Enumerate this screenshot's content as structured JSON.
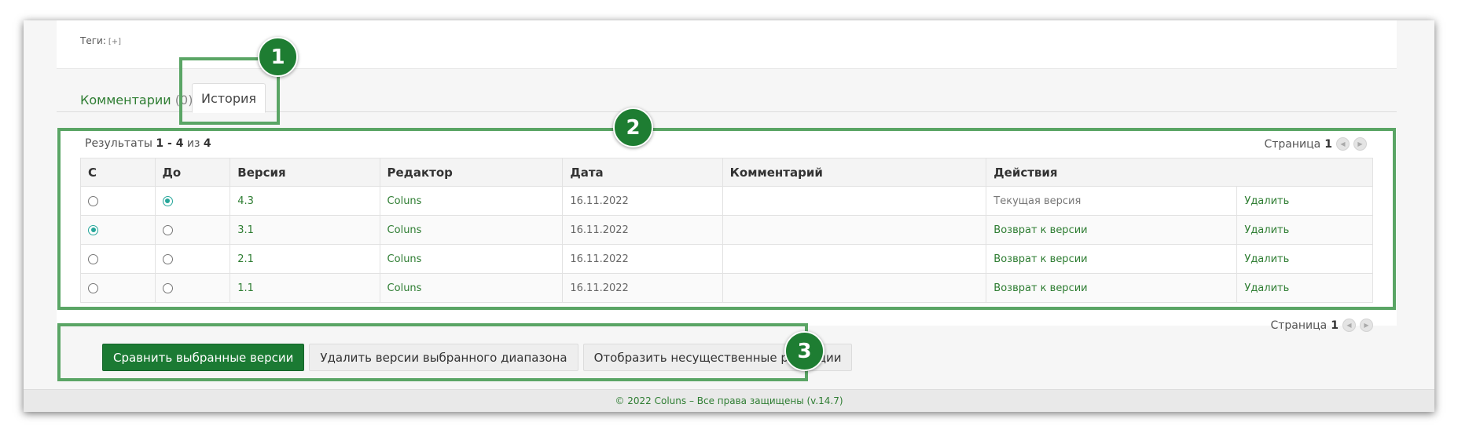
{
  "tags": {
    "label": "Теги:",
    "add_label": "[+]"
  },
  "tabs": {
    "comments_label": "Комментарии",
    "comments_count": "(0)",
    "history_label": "История"
  },
  "results": {
    "prefix": "Результаты",
    "range": "1 - 4",
    "of": "из",
    "total": "4"
  },
  "pager": {
    "label": "Страница",
    "page": "1"
  },
  "table": {
    "headers": [
      "С",
      "До",
      "Версия",
      "Редактор",
      "Дата",
      "Комментарий",
      "Действия"
    ],
    "rows": [
      {
        "from_selected": false,
        "to_selected": true,
        "version": "4.3",
        "editor": "Coluns",
        "date": "16.11.2022",
        "comment": "",
        "action": "Текущая версия",
        "action_link": false,
        "delete": "Удалить"
      },
      {
        "from_selected": true,
        "to_selected": false,
        "version": "3.1",
        "editor": "Coluns",
        "date": "16.11.2022",
        "comment": "",
        "action": "Возврат к версии",
        "action_link": true,
        "delete": "Удалить"
      },
      {
        "from_selected": false,
        "to_selected": false,
        "version": "2.1",
        "editor": "Coluns",
        "date": "16.11.2022",
        "comment": "",
        "action": "Возврат к версии",
        "action_link": true,
        "delete": "Удалить"
      },
      {
        "from_selected": false,
        "to_selected": false,
        "version": "1.1",
        "editor": "Coluns",
        "date": "16.11.2022",
        "comment": "",
        "action": "Возврат к версии",
        "action_link": true,
        "delete": "Удалить"
      }
    ]
  },
  "buttons": {
    "compare": "Сравнить выбранные версии",
    "delete_range": "Удалить версии выбранного диапазона",
    "show_minor": "Отобразить несущественные редакции"
  },
  "footer": {
    "text": "© 2022 Coluns – Все права защищены (v.14.7)"
  },
  "callouts": {
    "one": "1",
    "two": "2",
    "three": "3"
  },
  "colors": {
    "accent": "#1b7a33",
    "link": "#2e7d32",
    "callout": "#5aa565",
    "radio": "#26a69a"
  }
}
